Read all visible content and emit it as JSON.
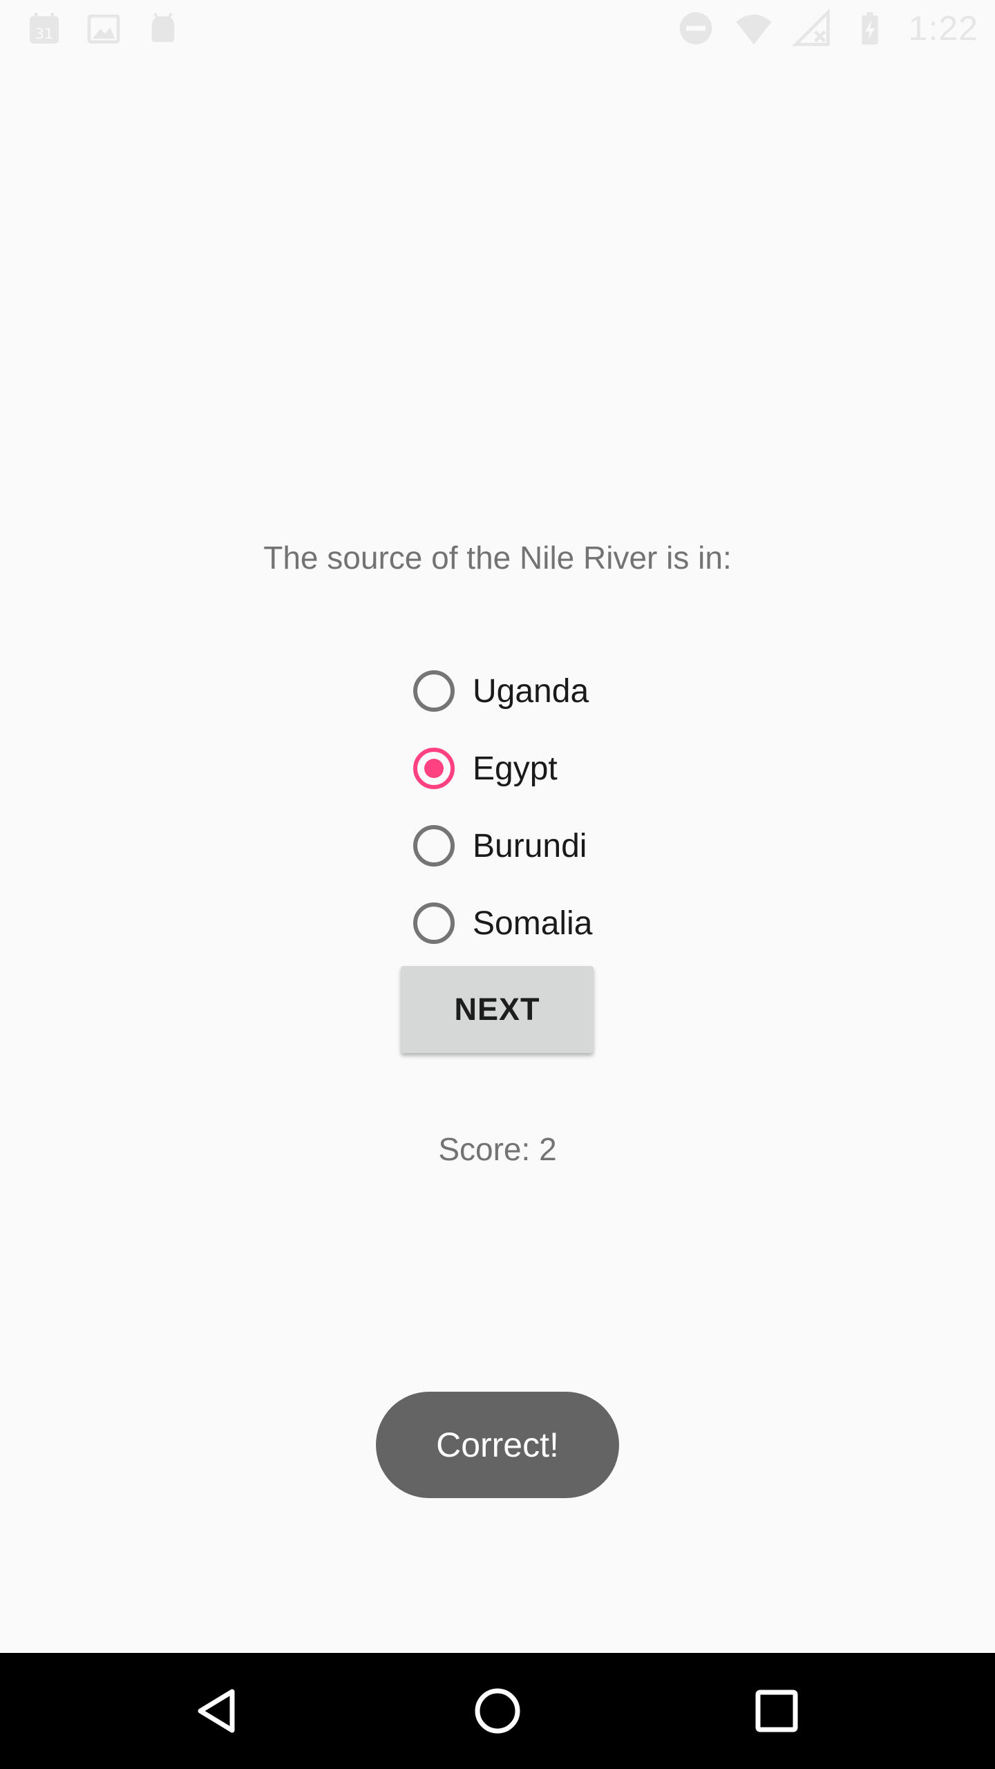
{
  "status_bar": {
    "time": "1:22",
    "left_icons": [
      "calendar-icon",
      "image-icon",
      "android-icon"
    ],
    "right_icons": [
      "do-not-disturb-icon",
      "wifi-icon",
      "signal-icon",
      "battery-icon"
    ]
  },
  "quiz": {
    "question": "The source of the Nile River is in:",
    "options": [
      {
        "label": "Uganda",
        "checked": false
      },
      {
        "label": "Egypt",
        "checked": true
      },
      {
        "label": "Burundi",
        "checked": false
      },
      {
        "label": "Somalia",
        "checked": false
      }
    ],
    "next_label": "NEXT",
    "score_text": "Score: 2"
  },
  "toast": {
    "message": "Correct!"
  },
  "colors": {
    "accent": "#ff4081",
    "background": "#fafafa",
    "button": "#d6d7d7",
    "toast": "#646464"
  }
}
